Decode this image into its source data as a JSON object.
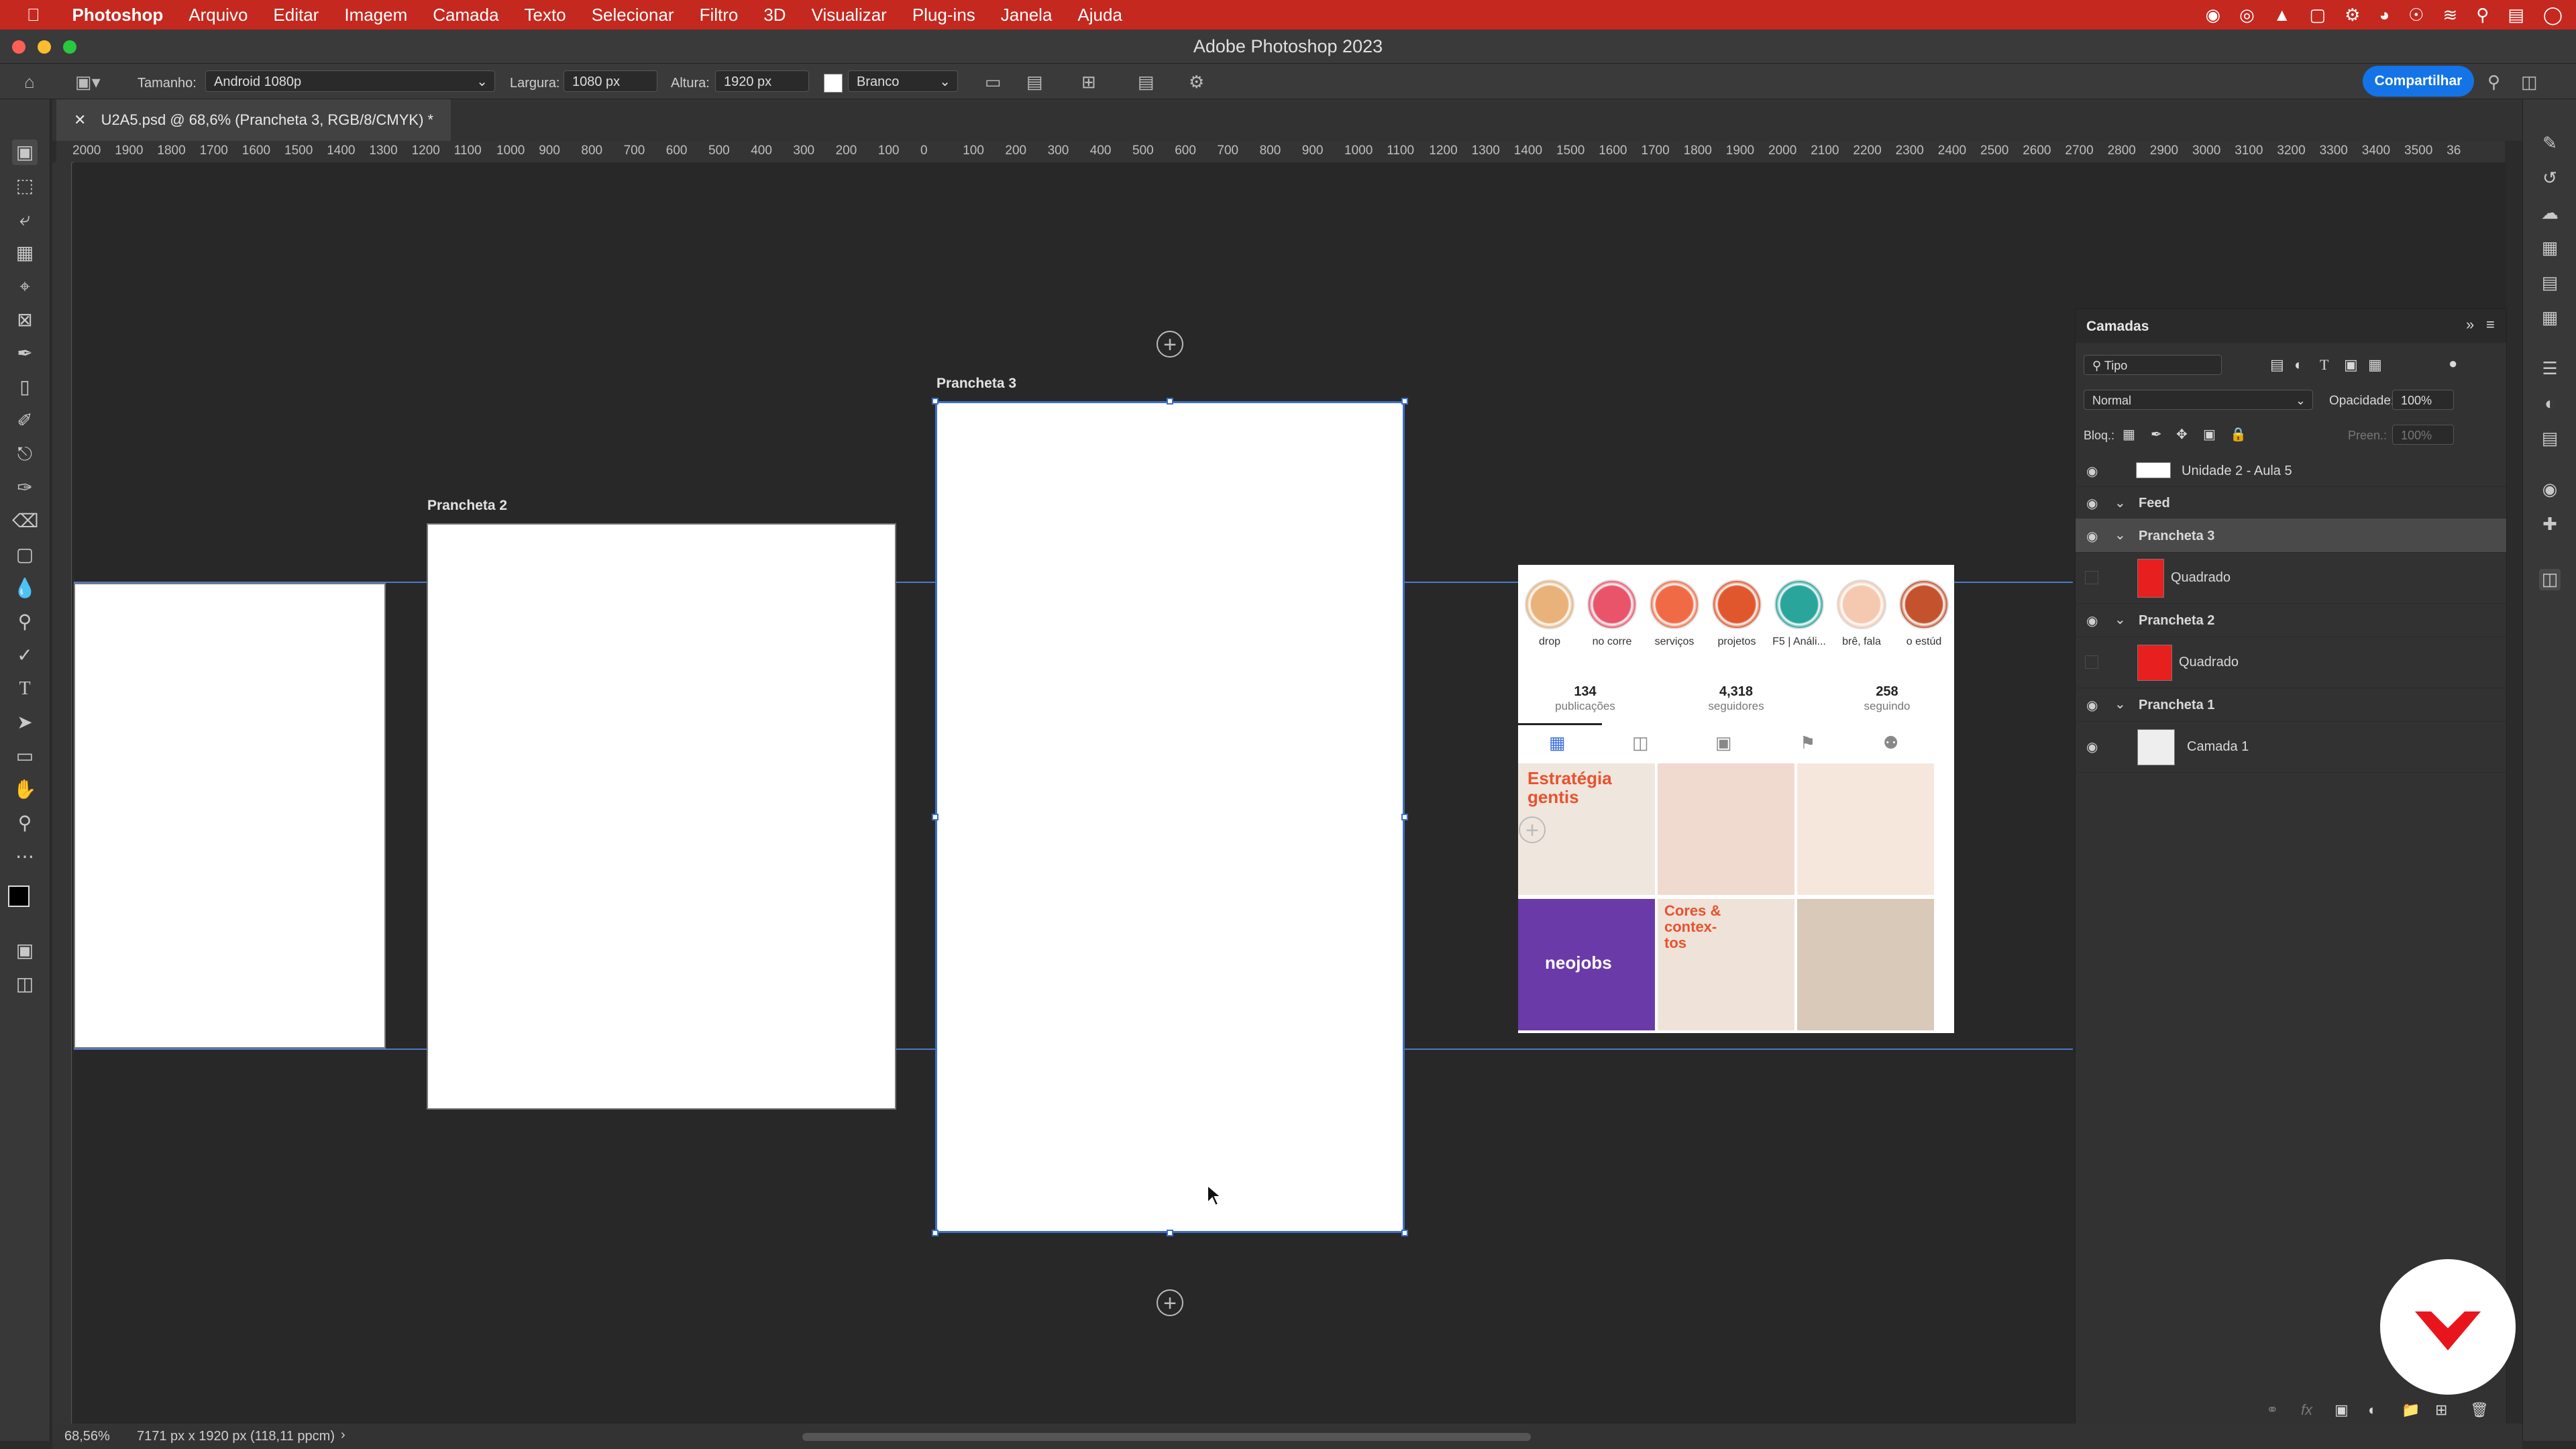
{
  "menubar": {
    "app": "Photoshop",
    "items": [
      "Arquivo",
      "Editar",
      "Imagem",
      "Camada",
      "Texto",
      "Selecionar",
      "Filtro",
      "3D",
      "Visualizar",
      "Plug-ins",
      "Janela",
      "Ajuda"
    ]
  },
  "window": {
    "title": "Adobe Photoshop 2023"
  },
  "options": {
    "size_label": "Tamanho:",
    "size_value": "Android 1080p",
    "width_label": "Largura:",
    "width_value": "1080 px",
    "height_label": "Altura:",
    "height_value": "1920 px",
    "bg_value": "Branco",
    "share_label": "Compartilhar"
  },
  "document": {
    "tab": "U2A5.psd @ 68,6% (Prancheta 3, RGB/8/CMYK) *"
  },
  "ruler": {
    "ticks": [
      "2000",
      "1900",
      "1800",
      "1700",
      "1600",
      "1500",
      "1400",
      "1300",
      "1200",
      "1100",
      "1000",
      "900",
      "800",
      "700",
      "600",
      "500",
      "400",
      "300",
      "200",
      "100",
      "0",
      "100",
      "200",
      "300",
      "400",
      "500",
      "600",
      "700",
      "800",
      "900",
      "1000",
      "1100",
      "1200",
      "1300",
      "1400",
      "1500",
      "1600",
      "1700",
      "1800",
      "1900",
      "2000",
      "2100",
      "2200",
      "2300",
      "2400",
      "2500",
      "2600",
      "2700",
      "2800",
      "2900",
      "3000",
      "3100",
      "3200",
      "3300",
      "3400",
      "3500",
      "36"
    ]
  },
  "artboards": {
    "a2": "Prancheta 2",
    "a3": "Prancheta 3"
  },
  "instagram": {
    "highlights": [
      "drop",
      "no corre",
      "serviços",
      "projetos",
      "F5 | Análi...",
      "brê, fala",
      "o estúd"
    ],
    "highlight_colors": [
      "#e9b27a",
      "#e9546b",
      "#f06b45",
      "#e0572e",
      "#2aa59b",
      "#f5c9b0",
      "#c4532d"
    ],
    "stats": [
      {
        "n": "134",
        "l": "publicações"
      },
      {
        "n": "4,318",
        "l": "seguidores"
      },
      {
        "n": "258",
        "l": "seguindo"
      }
    ],
    "tiles": [
      {
        "text": "Estratégia gentis",
        "bg": "#efe6de",
        "fg": "#e8522e"
      },
      {
        "text": "",
        "bg": "#f0d9cf",
        "fg": "#e85a2c"
      },
      {
        "text": "",
        "bg": "#f6e7dc",
        "fg": "#e86a2c"
      },
      {
        "text": "neojobs",
        "bg": "#6a3aa8",
        "fg": "#ffffff"
      },
      {
        "text": "Cores & contex-tos",
        "bg": "#efe2d9",
        "fg": "#e8522e"
      },
      {
        "text": "",
        "bg": "#d8c9b8",
        "fg": "#c8562e"
      }
    ]
  },
  "layers": {
    "title": "Camadas",
    "filter": "Tipo",
    "blend": "Normal",
    "opacity_label": "Opacidade:",
    "opacity_value": "100%",
    "lock_label": "Bloq.:",
    "fill_label": "Preen.:",
    "fill_value": "100%",
    "items": [
      {
        "name": "Unidade 2 - Aula 5"
      },
      {
        "name": "Feed"
      },
      {
        "name": "Prancheta 3"
      },
      {
        "name": "Quadrado"
      },
      {
        "name": "Prancheta 2"
      },
      {
        "name": "Quadrado"
      },
      {
        "name": "Prancheta 1"
      },
      {
        "name": "Camada 1"
      }
    ]
  },
  "status": {
    "zoom": "68,56%",
    "info": "7171 px x 1920 px (118,11 ppcm)"
  },
  "colors": {
    "accent": "#1473e6",
    "menubar": "#c5281f",
    "guide": "#4a78c9"
  }
}
